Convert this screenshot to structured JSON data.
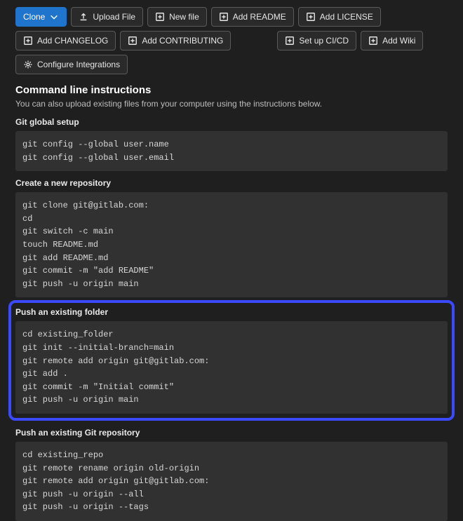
{
  "toolbar": {
    "clone_label": "Clone",
    "upload_file": "Upload File",
    "new_file": "New file",
    "add_readme": "Add README",
    "add_license": "Add LICENSE",
    "add_changelog": "Add CHANGELOG",
    "add_contributing": "Add CONTRIBUTING",
    "setup_cicd": "Set up CI/CD",
    "add_wiki": "Add Wiki",
    "configure_integrations": "Configure Integrations"
  },
  "cli": {
    "title": "Command line instructions",
    "desc": "You can also upload existing files from your computer using the instructions below.",
    "global_setup_heading": "Git global setup",
    "global_setup_code": "git config --global user.name\ngit config --global user.email",
    "create_repo_heading": "Create a new repository",
    "create_repo_code": "git clone git@gitlab.com:\ncd\ngit switch -c main\ntouch README.md\ngit add README.md\ngit commit -m \"add README\"\ngit push -u origin main",
    "push_folder_heading": "Push an existing folder",
    "push_folder_code": "cd existing_folder\ngit init --initial-branch=main\ngit remote add origin git@gitlab.com:\ngit add .\ngit commit -m \"Initial commit\"\ngit push -u origin main",
    "push_repo_heading": "Push an existing Git repository",
    "push_repo_code": "cd existing_repo\ngit remote rename origin old-origin\ngit remote add origin git@gitlab.com:\ngit push -u origin --all\ngit push -u origin --tags"
  },
  "highlight_color": "#3b49ff"
}
